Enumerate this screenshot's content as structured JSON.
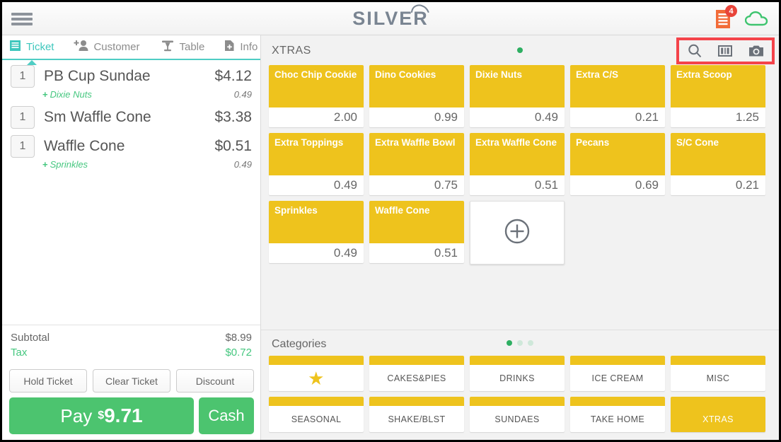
{
  "header": {
    "logo_text": "SILVER",
    "menu_icon": "hamburger-icon",
    "receipt_icon": "receipt-icon",
    "receipt_badge": "4",
    "cloud_icon": "cloud-icon"
  },
  "left_panel": {
    "tabs": [
      {
        "label": "Ticket",
        "icon": "ticket-icon",
        "active": true
      },
      {
        "label": "Customer",
        "icon": "add-customer-icon",
        "active": false
      },
      {
        "label": "Table",
        "icon": "table-icon",
        "active": false
      },
      {
        "label": "Info",
        "icon": "info-document-icon",
        "active": false
      }
    ],
    "items": [
      {
        "qty": "1",
        "name": "PB Cup Sundae",
        "price": "$4.12",
        "modifiers": [
          {
            "name": "Dixie Nuts",
            "price": "0.49"
          }
        ]
      },
      {
        "qty": "1",
        "name": "Sm Waffle Cone",
        "price": "$3.38",
        "modifiers": []
      },
      {
        "qty": "1",
        "name": "Waffle Cone",
        "price": "$0.51",
        "modifiers": [
          {
            "name": "Sprinkles",
            "price": "0.49"
          }
        ]
      }
    ],
    "totals": [
      {
        "label": "Subtotal",
        "value": "$8.99"
      },
      {
        "label": "Tax",
        "value": "$0.72"
      }
    ],
    "actions": [
      {
        "label": "Hold Ticket"
      },
      {
        "label": "Clear Ticket"
      },
      {
        "label": "Discount"
      }
    ],
    "pay": {
      "label": "Pay",
      "currency": "$",
      "amount": "9.71"
    },
    "cash": {
      "label": "Cash"
    }
  },
  "products": {
    "title": "XTRAS",
    "pager": {
      "count": 1,
      "active": 0
    },
    "toolbar": [
      {
        "icon": "search-icon"
      },
      {
        "icon": "barcode-icon"
      },
      {
        "icon": "camera-icon"
      }
    ],
    "tiles": [
      {
        "name": "Choc Chip Cookie",
        "price": "2.00"
      },
      {
        "name": "Dino Cookies",
        "price": "0.99"
      },
      {
        "name": "Dixie Nuts",
        "price": "0.49"
      },
      {
        "name": "Extra C/S",
        "price": "0.21"
      },
      {
        "name": "Extra Scoop",
        "price": "1.25"
      },
      {
        "name": "Extra Toppings",
        "price": "0.49"
      },
      {
        "name": "Extra Waffle Bowl",
        "price": "0.75"
      },
      {
        "name": "Extra Waffle Cone",
        "price": "0.51"
      },
      {
        "name": "Pecans",
        "price": "0.69"
      },
      {
        "name": "S/C Cone",
        "price": "0.21"
      },
      {
        "name": "Sprinkles",
        "price": "0.49"
      },
      {
        "name": "Waffle Cone",
        "price": "0.51"
      }
    ],
    "add_tile": {
      "icon": "plus-circle-icon"
    }
  },
  "categories": {
    "title": "Categories",
    "pager": {
      "count": 3,
      "active": 0
    },
    "items": [
      {
        "label": "",
        "icon": "star-icon",
        "selected": false
      },
      {
        "label": "CAKES&PIES",
        "selected": false
      },
      {
        "label": "DRINKS",
        "selected": false
      },
      {
        "label": "ICE CREAM",
        "selected": false
      },
      {
        "label": "MISC",
        "selected": false
      },
      {
        "label": "SEASONAL",
        "selected": false
      },
      {
        "label": "SHAKE/BLST",
        "selected": false
      },
      {
        "label": "SUNDAES",
        "selected": false
      },
      {
        "label": "TAKE HOME",
        "selected": false
      },
      {
        "label": "XTRAS",
        "selected": true
      }
    ]
  },
  "colors": {
    "accent_yellow": "#eec31d",
    "green": "#4cc46f",
    "teal": "#4ecdc4",
    "highlight_red": "#f4434a",
    "orange": "#f26b38"
  }
}
